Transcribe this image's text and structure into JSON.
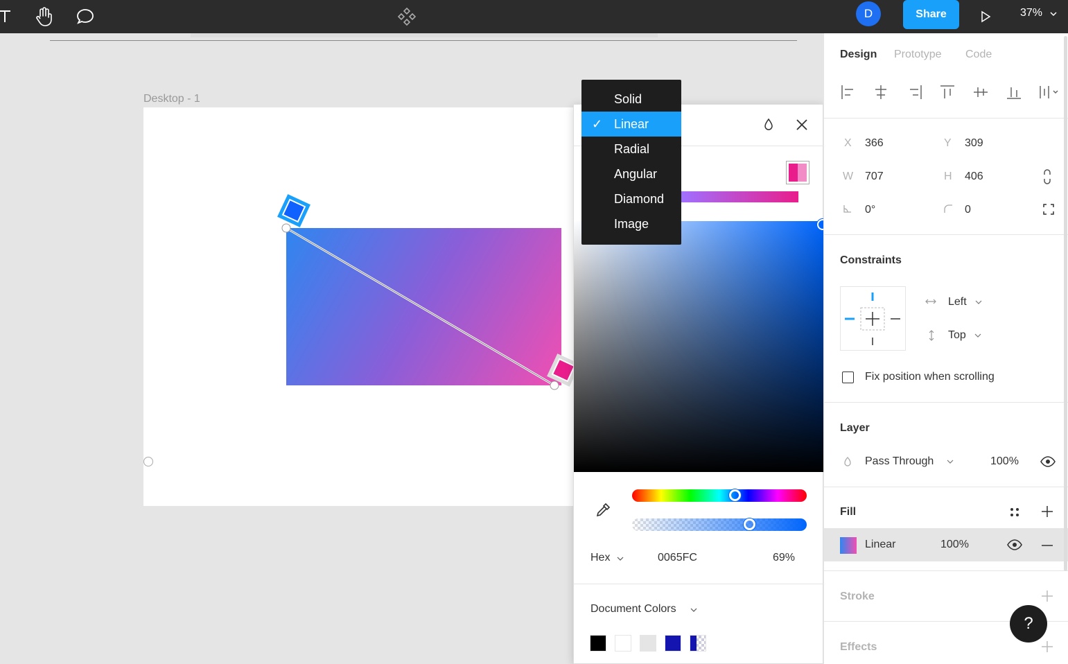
{
  "topbar": {
    "zoom": "37%",
    "avatar_initial": "D",
    "share_label": "Share"
  },
  "canvas": {
    "frame_label": "Desktop - 1"
  },
  "fill_menu": {
    "items": [
      "Solid",
      "Linear",
      "Radial",
      "Angular",
      "Diamond",
      "Image"
    ],
    "selected": "Linear"
  },
  "picker": {
    "format": "Hex",
    "hex": "0065FC",
    "opacity": "69%",
    "document_colors_label": "Document Colors",
    "swatches": [
      "#000000",
      "#ffffff",
      "#e5e5e5",
      "#1414b0"
    ]
  },
  "panel": {
    "tabs": {
      "design": "Design",
      "prototype": "Prototype",
      "code": "Code"
    },
    "x_label": "X",
    "x": "366",
    "y_label": "Y",
    "y": "309",
    "w_label": "W",
    "w": "707",
    "h_label": "H",
    "h": "406",
    "rotation": "0°",
    "radius": "0",
    "constraints": {
      "title": "Constraints",
      "horizontal": "Left",
      "vertical": "Top",
      "fix_label": "Fix position when scrolling"
    },
    "layer": {
      "title": "Layer",
      "blend": "Pass Through",
      "opacity": "100%"
    },
    "fill": {
      "title": "Fill",
      "type": "Linear",
      "opacity": "100%"
    },
    "stroke_title": "Stroke",
    "effects_title": "Effects"
  },
  "help_label": "?"
}
